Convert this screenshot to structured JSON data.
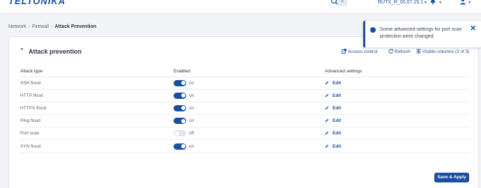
{
  "header": {
    "logo": "TELTONIKA",
    "firmware": "RUTX_R_00.07.15.1",
    "search_close": "✕"
  },
  "breadcrumb": [
    "Network",
    "Firewall",
    "Attack Prevention"
  ],
  "card": {
    "title": "Attack prevention",
    "access_control": "Access control",
    "refresh": "Refresh",
    "visible_columns": "Visible columns (3 of 3)"
  },
  "table": {
    "headers": [
      "Attack type",
      "Enabled",
      "Advanced settings"
    ],
    "rows": [
      {
        "type": "SSH flood",
        "enabled": true,
        "state": "on",
        "edit": "Edit"
      },
      {
        "type": "HTTP flood",
        "enabled": true,
        "state": "on",
        "edit": "Edit"
      },
      {
        "type": "HTTPS flood",
        "enabled": true,
        "state": "on",
        "edit": "Edit"
      },
      {
        "type": "Ping flood",
        "enabled": true,
        "state": "on",
        "edit": "Edit"
      },
      {
        "type": "Port scan",
        "enabled": false,
        "state": "off",
        "edit": "Edit"
      },
      {
        "type": "SYN flood",
        "enabled": true,
        "state": "on",
        "edit": "Edit"
      }
    ]
  },
  "save_apply": "Save & Apply",
  "toast": {
    "message": "Some advanced settings for port scan protection were changed.",
    "close": "✕"
  },
  "colors": {
    "accent": "#1a4fa0",
    "toggle_off": "#e3e6ec"
  },
  "icons": [
    "search-icon",
    "bell-icon",
    "user-icon",
    "external-link-icon",
    "refresh-icon",
    "columns-icon",
    "pencil-icon",
    "info-icon",
    "chevron-up-icon"
  ]
}
